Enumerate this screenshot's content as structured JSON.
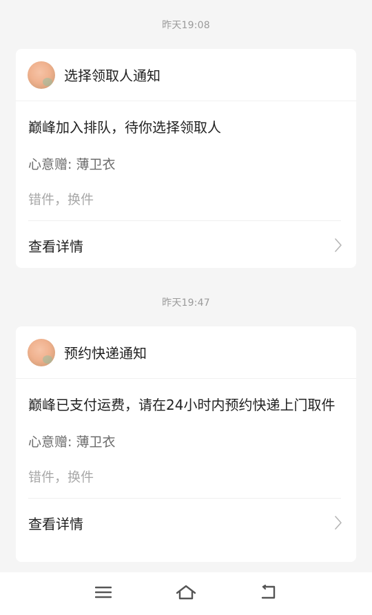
{
  "notifications": [
    {
      "timestamp": "昨天19:08",
      "title": "选择领取人通知",
      "message": "巅峰加入排队，待你选择领取人",
      "gift": "心意赠: 薄卫衣",
      "tags": "错件，换件",
      "detail_label": "查看详情"
    },
    {
      "timestamp": "昨天19:47",
      "title": "预约快递通知",
      "message": "巅峰已支付运费，请在24小时内预约快递上门取件",
      "gift": "心意赠: 薄卫衣",
      "tags": "错件，换件",
      "detail_label": "查看详情"
    }
  ],
  "navbar": {
    "icons": [
      "menu-icon",
      "home-icon",
      "back-icon"
    ]
  },
  "colors": {
    "background": "#f5f5f5",
    "card": "#ffffff",
    "timestamp": "#9a9a9a",
    "secondary_text": "#6b6b6b",
    "tertiary_text": "#a8a8a8"
  }
}
